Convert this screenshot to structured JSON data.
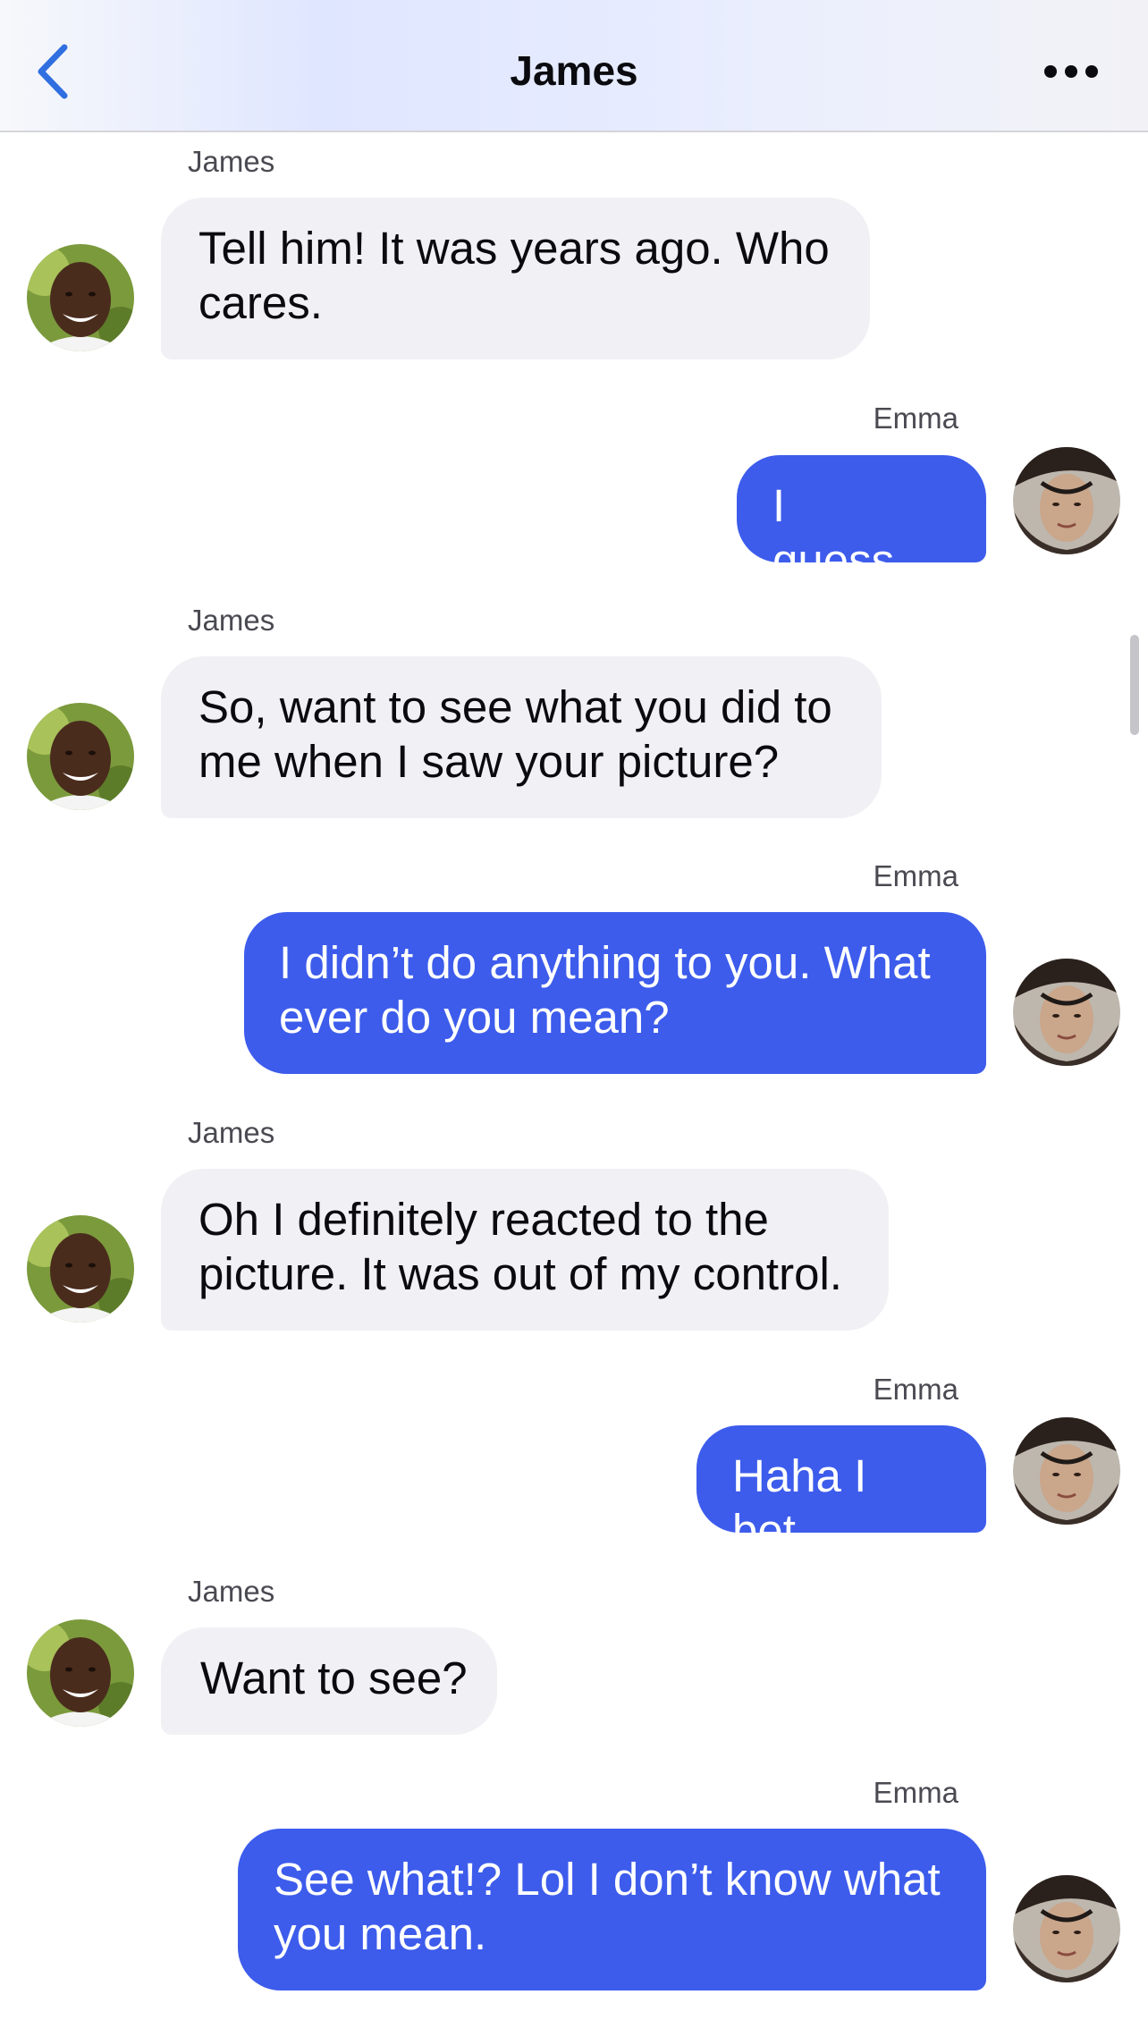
{
  "header": {
    "title": "James",
    "back_icon": "chevron-left-icon",
    "more_icon": "ellipsis-icon",
    "accent_color": "#2f6fe0"
  },
  "colors": {
    "outgoing_bubble": "#3d5cec",
    "incoming_bubble": "#f1f1f5"
  },
  "messages": [
    {
      "sender": "James",
      "direction": "incoming",
      "text": "Tell him! It was years ago. Who cares."
    },
    {
      "sender": "Emma",
      "direction": "outgoing",
      "text": "I guess..."
    },
    {
      "sender": "James",
      "direction": "incoming",
      "text": "So, want to see what you did to me when I saw your picture?"
    },
    {
      "sender": "Emma",
      "direction": "outgoing",
      "text": "I didn’t do anything to you. What ever do you mean?"
    },
    {
      "sender": "James",
      "direction": "incoming",
      "text": "Oh I definitely reacted to the picture. It was out of my control."
    },
    {
      "sender": "Emma",
      "direction": "outgoing",
      "text": "Haha I bet."
    },
    {
      "sender": "James",
      "direction": "incoming",
      "text": "Want to see?"
    },
    {
      "sender": "Emma",
      "direction": "outgoing",
      "text": "See what!? Lol I don’t know what you mean."
    }
  ]
}
